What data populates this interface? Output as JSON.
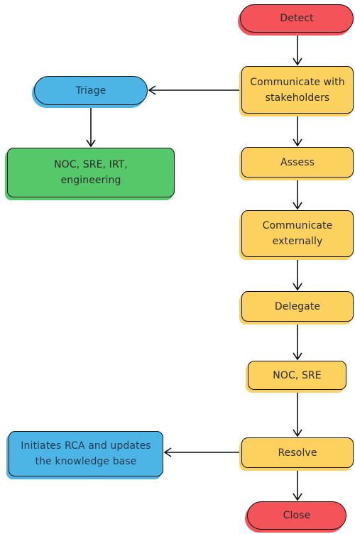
{
  "diagram": {
    "type": "flowchart",
    "colors": {
      "start_end": "#f35359",
      "process": "#fcd15e",
      "side_process": "#4db4e6",
      "team": "#55c86a",
      "edge": "#111111"
    },
    "nodes": {
      "detect": {
        "label": "Detect",
        "shape": "terminator",
        "color": "start_end"
      },
      "communicate_stakeholders": {
        "label": "Communicate with stakeholders",
        "shape": "process",
        "color": "process"
      },
      "triage": {
        "label": "Triage",
        "shape": "terminator",
        "color": "side_process"
      },
      "triage_teams": {
        "label": "NOC, SRE, IRT, engineering",
        "shape": "process",
        "color": "team"
      },
      "assess": {
        "label": "Assess",
        "shape": "process",
        "color": "process"
      },
      "communicate_externally": {
        "label": "Communicate externally",
        "shape": "process",
        "color": "process"
      },
      "delegate": {
        "label": "Delegate",
        "shape": "process",
        "color": "process"
      },
      "delegate_teams": {
        "label": "NOC, SRE",
        "shape": "process",
        "color": "process"
      },
      "resolve": {
        "label": "Resolve",
        "shape": "process",
        "color": "process"
      },
      "rca": {
        "label": "Initiates RCA and updates the knowledge base",
        "shape": "process",
        "color": "side_process"
      },
      "close": {
        "label": "Close",
        "shape": "terminator",
        "color": "start_end"
      }
    },
    "edges": [
      {
        "from": "detect",
        "to": "communicate_stakeholders"
      },
      {
        "from": "communicate_stakeholders",
        "to": "triage"
      },
      {
        "from": "triage",
        "to": "triage_teams"
      },
      {
        "from": "communicate_stakeholders",
        "to": "assess"
      },
      {
        "from": "assess",
        "to": "communicate_externally"
      },
      {
        "from": "communicate_externally",
        "to": "delegate"
      },
      {
        "from": "delegate",
        "to": "delegate_teams"
      },
      {
        "from": "delegate_teams",
        "to": "resolve"
      },
      {
        "from": "resolve",
        "to": "rca"
      },
      {
        "from": "resolve",
        "to": "close"
      }
    ]
  }
}
